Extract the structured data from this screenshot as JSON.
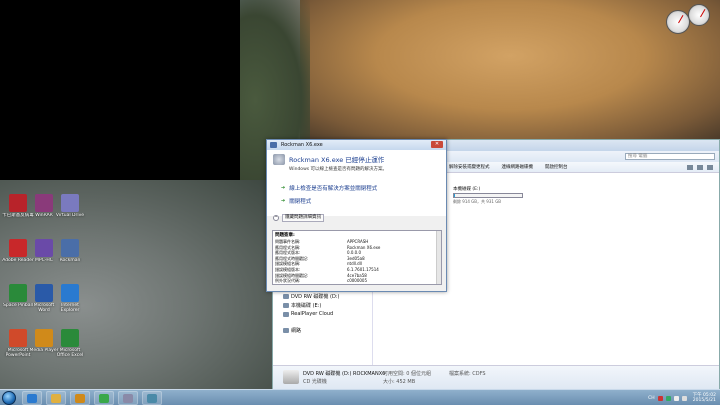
{
  "colors": {
    "accent": "#1a3d8f",
    "progress": "#26a0da"
  },
  "desktop": {
    "icons": [
      {
        "name": "kaspersky-icon",
        "label": "卡巴斯基反病毒",
        "color": "#b8232a"
      },
      {
        "name": "winrar-icon",
        "label": "WinRAR",
        "color": "#8a3a7a"
      },
      {
        "name": "virtualdrive-icon",
        "label": "Virtual Drive",
        "color": "#7a7abf"
      },
      {
        "name": "acrobat-icon",
        "label": "Adobe Reader",
        "color": "#c8282a"
      },
      {
        "name": "mpc-icon",
        "label": "MPC-HC",
        "color": "#6a4aa8"
      },
      {
        "name": "rockman-icon",
        "label": "Rockman",
        "color": "#4a6ea8"
      },
      {
        "name": "pinball-icon",
        "label": "Space Pinball",
        "color": "#2a8a3a"
      },
      {
        "name": "word-icon",
        "label": "Microsoft Word",
        "color": "#2a5aa8"
      },
      {
        "name": "ie-icon",
        "label": "Internet Explorer",
        "color": "#2a7ad0"
      },
      {
        "name": "powerpoint-icon",
        "label": "Microsoft PowerPoint",
        "color": "#d04a2a"
      },
      {
        "name": "media-icon",
        "label": "Media Player",
        "color": "#d08a1a"
      },
      {
        "name": "excel-icon",
        "label": "Microsoft Office Excel",
        "color": "#2a8a3a"
      }
    ]
  },
  "explorer": {
    "search_placeholder": "搜尋 電腦",
    "toolbar": [
      "解除安裝或變更程式",
      "連線網路磁碟機",
      "開啟控制台"
    ],
    "nav": [
      "DVD RW 磁碟機 (D:)",
      "本機磁碟 (E:)",
      "RealPlayer Cloud",
      "網路"
    ],
    "drive": {
      "name": "本機磁碟 (E:)",
      "free": "剩餘 914 GB，共 931 GB",
      "used_fraction": 0.02
    },
    "details": {
      "title": "DVD RW 磁碟機 (D:) ROCKMANX6",
      "type": "CD 光碟機",
      "used": "可用空間: 0 個位元組",
      "size": "大小: 452 MB",
      "fs": "檔案系統: CDFS"
    }
  },
  "dialog": {
    "window_title": "Rockman X6.exe",
    "heading": "Rockman X6.exe 已經停止運作",
    "description": "Windows 可以線上檢查是否有問題的解決方案。",
    "option1": "線上檢查是否有解決方案並關閉程式",
    "option2": "關閉程式",
    "toggle_label": "隱藏問題詳細資訊",
    "close_label": "✕",
    "details_header": "問題簽章:",
    "details": [
      {
        "k": "問題事件名稱:",
        "v": "APPCRASH"
      },
      {
        "k": "應用程式名稱:",
        "v": "Rockman X6.exe"
      },
      {
        "k": "應用程式版本:",
        "v": "0.0.0.0"
      },
      {
        "k": "應用程式時間戳記:",
        "v": "3ed05a8"
      },
      {
        "k": "錯誤模組名稱:",
        "v": "ntdll.dll"
      },
      {
        "k": "錯誤模組版本:",
        "v": "6.1.7601.17514"
      },
      {
        "k": "錯誤模組時間戳記:",
        "v": "4ce7ba58"
      },
      {
        "k": "例外狀況代碼:",
        "v": "c0000005"
      }
    ]
  },
  "taskbar": {
    "buttons": [
      {
        "name": "ie-taskbar-button",
        "color": "#2a7ad0"
      },
      {
        "name": "explorer-taskbar-button",
        "color": "#e0b040"
      },
      {
        "name": "media-taskbar-button",
        "color": "#d08a1a"
      },
      {
        "name": "chrome-taskbar-button",
        "color": "#3aa84a"
      },
      {
        "name": "rockman-taskbar-button",
        "color": "#8a8aa8"
      },
      {
        "name": "monitor-taskbar-button",
        "color": "#4a8aa8"
      }
    ],
    "language": "CH",
    "time": "下午 05:02",
    "date": "2015/5/21"
  }
}
